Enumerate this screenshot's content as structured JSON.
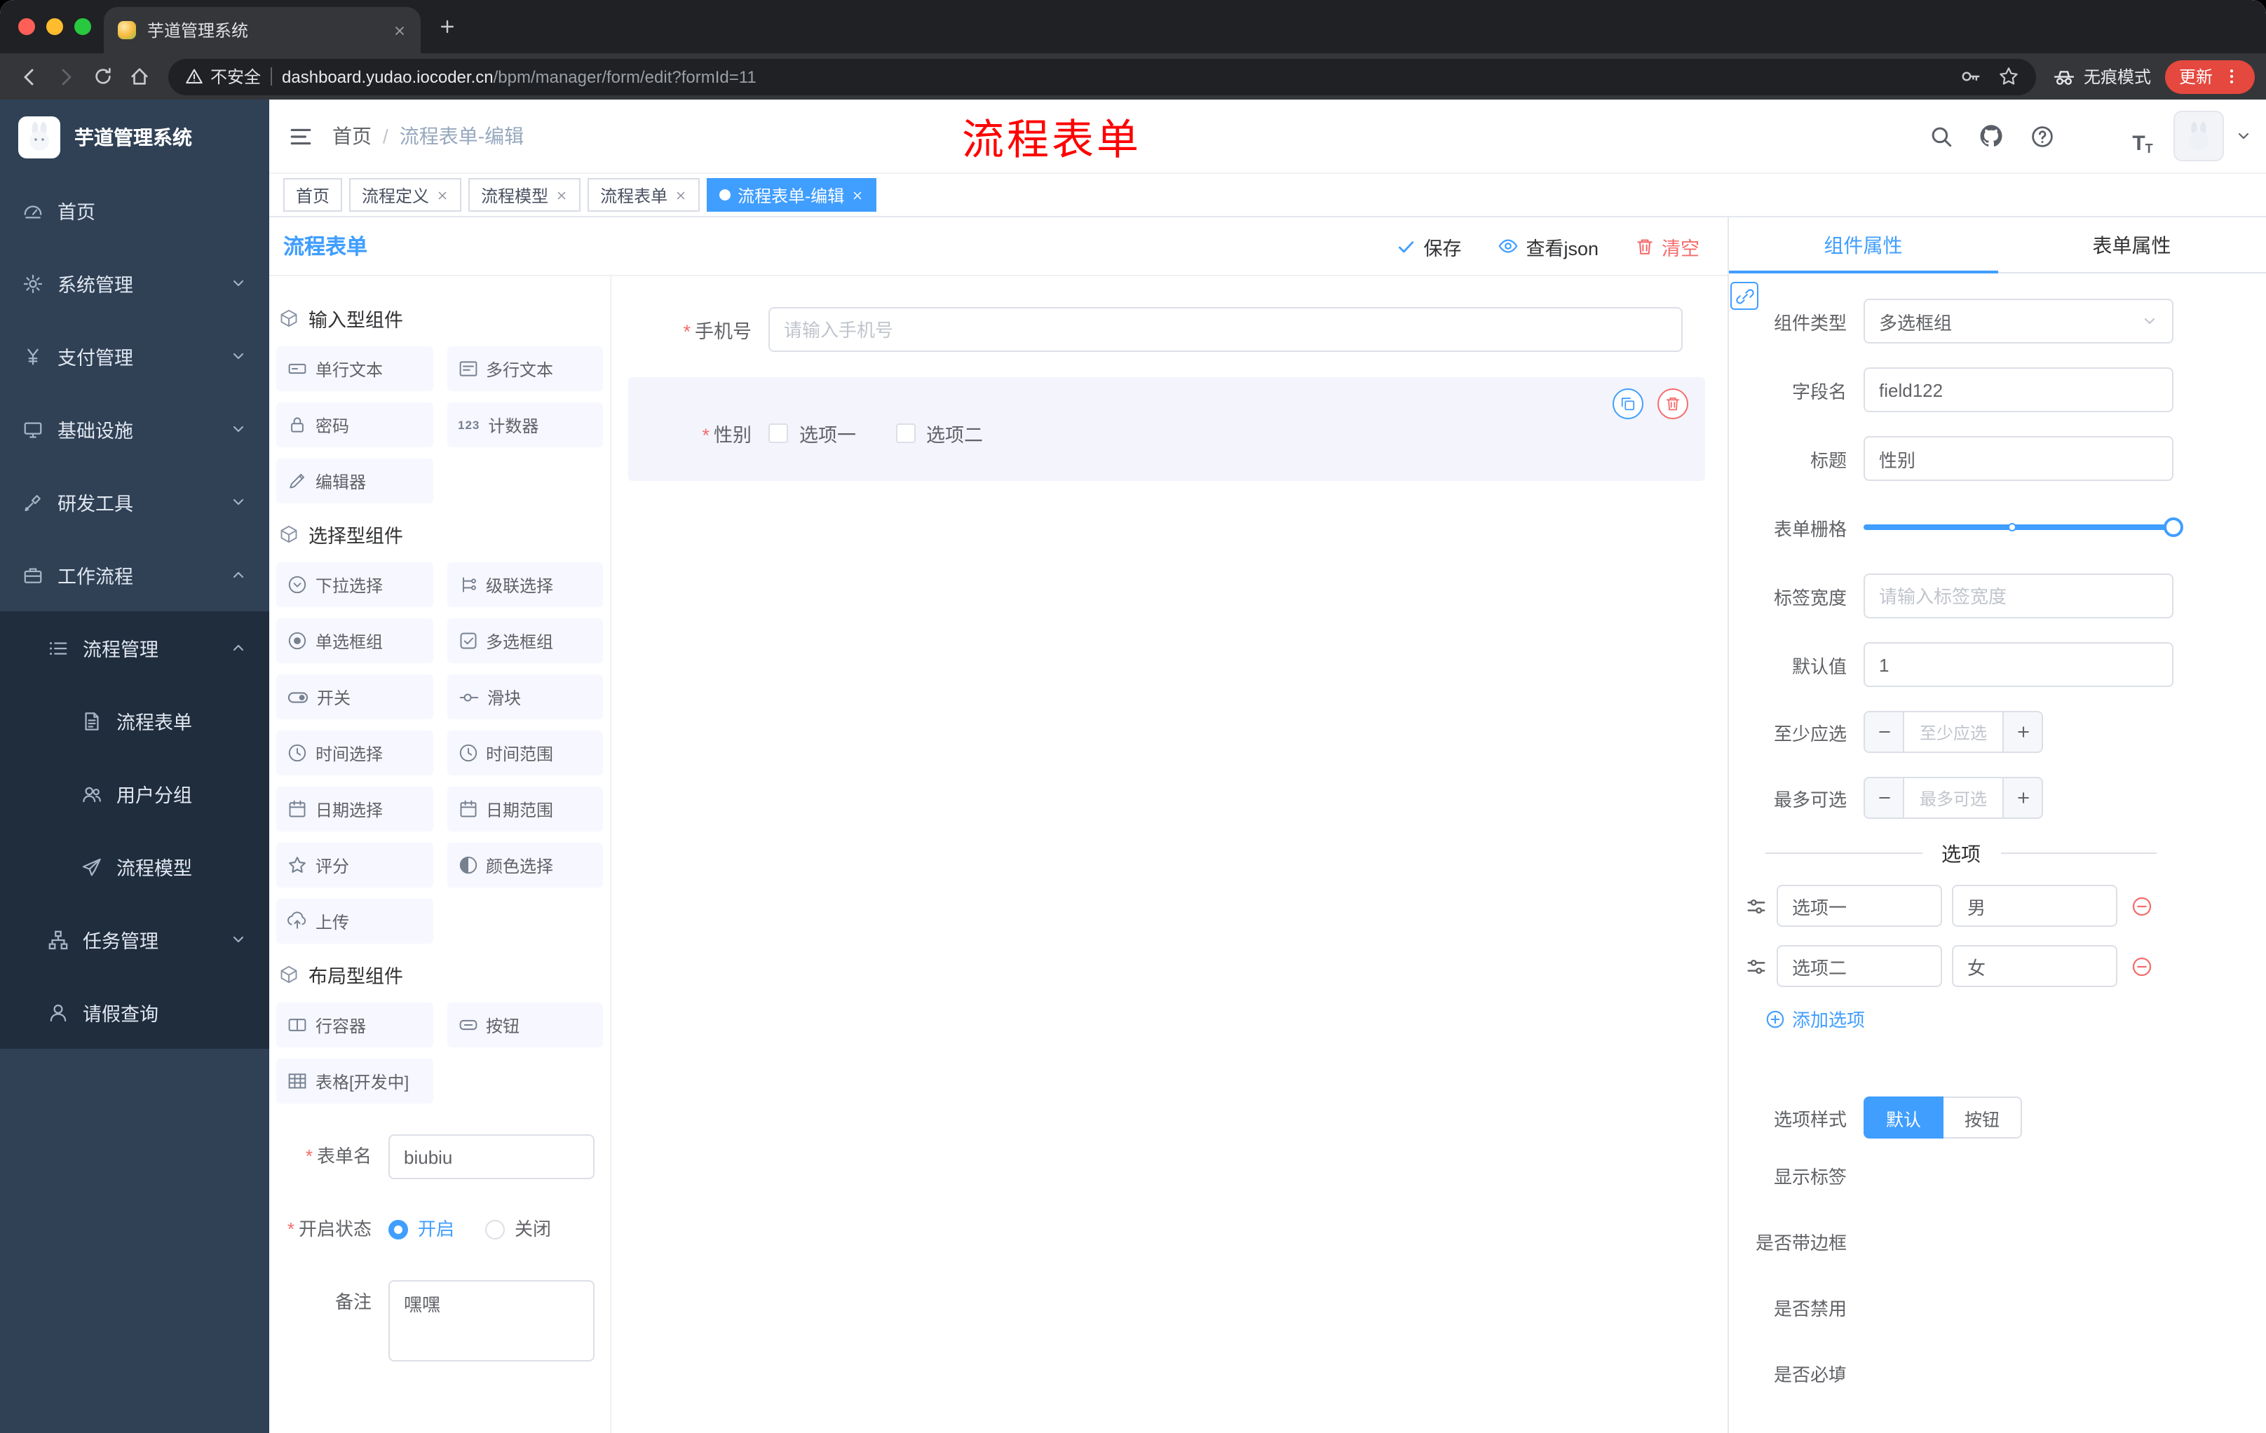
{
  "browser": {
    "tab": {
      "title": "芋道管理系统"
    },
    "address": {
      "security_label": "不安全",
      "host": "dashboard.yudao.iocoder.cn",
      "path": "/bpm/manager/form/edit?formId=11"
    },
    "incognito_label": "无痕模式",
    "update_label": "更新"
  },
  "sidebar": {
    "logo_title": "芋道管理系统",
    "menu": [
      {
        "label": "首页",
        "icon": "dashboard-icon",
        "level": 1
      },
      {
        "label": "系统管理",
        "icon": "gear-icon",
        "level": 1,
        "chevron": "down"
      },
      {
        "label": "支付管理",
        "icon": "yen-icon",
        "level": 1,
        "chevron": "down"
      },
      {
        "label": "基础设施",
        "icon": "monitor-icon",
        "level": 1,
        "chevron": "down"
      },
      {
        "label": "研发工具",
        "icon": "tool-icon",
        "level": 1,
        "chevron": "down"
      },
      {
        "label": "工作流程",
        "icon": "briefcase-icon",
        "level": 1,
        "chevron": "up"
      },
      {
        "label": "流程管理",
        "icon": "list-icon",
        "level": 2,
        "chevron": "up"
      },
      {
        "label": "流程表单",
        "icon": "document-icon",
        "level": 3
      },
      {
        "label": "用户分组",
        "icon": "users-icon",
        "level": 3
      },
      {
        "label": "流程模型",
        "icon": "send-icon",
        "level": 3
      },
      {
        "label": "任务管理",
        "icon": "tree-icon",
        "level": 2,
        "chevron": "down"
      },
      {
        "label": "请假查询",
        "icon": "user-icon",
        "level": 2
      }
    ]
  },
  "header": {
    "breadcrumb": [
      "首页",
      "流程表单-编辑"
    ],
    "annotation": "流程表单"
  },
  "tags": [
    {
      "label": "首页"
    },
    {
      "label": "流程定义"
    },
    {
      "label": "流程模型"
    },
    {
      "label": "流程表单"
    },
    {
      "label": "流程表单-编辑"
    }
  ],
  "editor": {
    "title": "流程表单",
    "actions": {
      "save": "保存",
      "view_json": "查看json",
      "clear": "清空"
    }
  },
  "palette": {
    "sections": [
      {
        "title": "输入型组件",
        "items": [
          {
            "label": "单行文本",
            "icon": "input-field-icon"
          },
          {
            "label": "多行文本",
            "icon": "textarea-icon"
          },
          {
            "label": "密码",
            "icon": "lock-icon"
          },
          {
            "label": "计数器",
            "icon": "counter-icon",
            "glyph": "123"
          },
          {
            "label": "编辑器",
            "icon": "editor-icon"
          }
        ]
      },
      {
        "title": "选择型组件",
        "items": [
          {
            "label": "下拉选择",
            "icon": "select-icon"
          },
          {
            "label": "级联选择",
            "icon": "cascade-icon"
          },
          {
            "label": "单选框组",
            "icon": "radio-icon"
          },
          {
            "label": "多选框组",
            "icon": "checkbox-icon"
          },
          {
            "label": "开关",
            "icon": "switch-icon"
          },
          {
            "label": "滑块",
            "icon": "slider-icon"
          },
          {
            "label": "时间选择",
            "icon": "time-icon"
          },
          {
            "label": "时间范围",
            "icon": "time-range-icon"
          },
          {
            "label": "日期选择",
            "icon": "date-icon"
          },
          {
            "label": "日期范围",
            "icon": "date-range-icon"
          },
          {
            "label": "评分",
            "icon": "rate-icon"
          },
          {
            "label": "颜色选择",
            "icon": "color-icon"
          },
          {
            "label": "上传",
            "icon": "upload-icon"
          }
        ]
      },
      {
        "title": "布局型组件",
        "items": [
          {
            "label": "行容器",
            "icon": "row-icon"
          },
          {
            "label": "按钮",
            "icon": "button-icon"
          },
          {
            "label": "表格[开发中]",
            "icon": "table-icon"
          }
        ]
      }
    ]
  },
  "form_meta": {
    "name_label": "表单名",
    "name_value": "biubiu",
    "status_label": "开启状态",
    "status_on": "开启",
    "status_off": "关闭",
    "remark_label": "备注",
    "remark_value": "嘿嘿"
  },
  "canvas": {
    "fields": [
      {
        "label": "手机号",
        "placeholder": "请输入手机号"
      },
      {
        "label": "性别",
        "options": [
          "选项一",
          "选项二"
        ]
      }
    ]
  },
  "properties": {
    "tabs": [
      "组件属性",
      "表单属性"
    ],
    "component_type": {
      "label": "组件类型",
      "value": "多选框组"
    },
    "field_name": {
      "label": "字段名",
      "value": "field122"
    },
    "title": {
      "label": "标题",
      "value": "性别"
    },
    "grid": {
      "label": "表单栅格"
    },
    "label_width": {
      "label": "标签宽度",
      "placeholder": "请输入标签宽度"
    },
    "default_value": {
      "label": "默认值",
      "value": "1"
    },
    "min_select": {
      "label": "至少应选",
      "placeholder": "至少应选"
    },
    "max_select": {
      "label": "最多可选",
      "placeholder": "最多可选"
    },
    "options_divider": "选项",
    "options": [
      {
        "label": "选项一",
        "value": "男"
      },
      {
        "label": "选项二",
        "value": "女"
      }
    ],
    "add_option": "添加选项",
    "option_style": {
      "label": "选项样式",
      "default": "默认",
      "button": "按钮"
    },
    "switches": [
      {
        "label": "显示标签",
        "on": true
      },
      {
        "label": "是否带边框",
        "on": false
      },
      {
        "label": "是否禁用",
        "on": false
      },
      {
        "label": "是否必填",
        "on": true
      }
    ]
  },
  "colors": {
    "accent": "#409eff",
    "danger": "#f56c6c",
    "sidebar": "#304156",
    "annotation": "#ff0000"
  }
}
